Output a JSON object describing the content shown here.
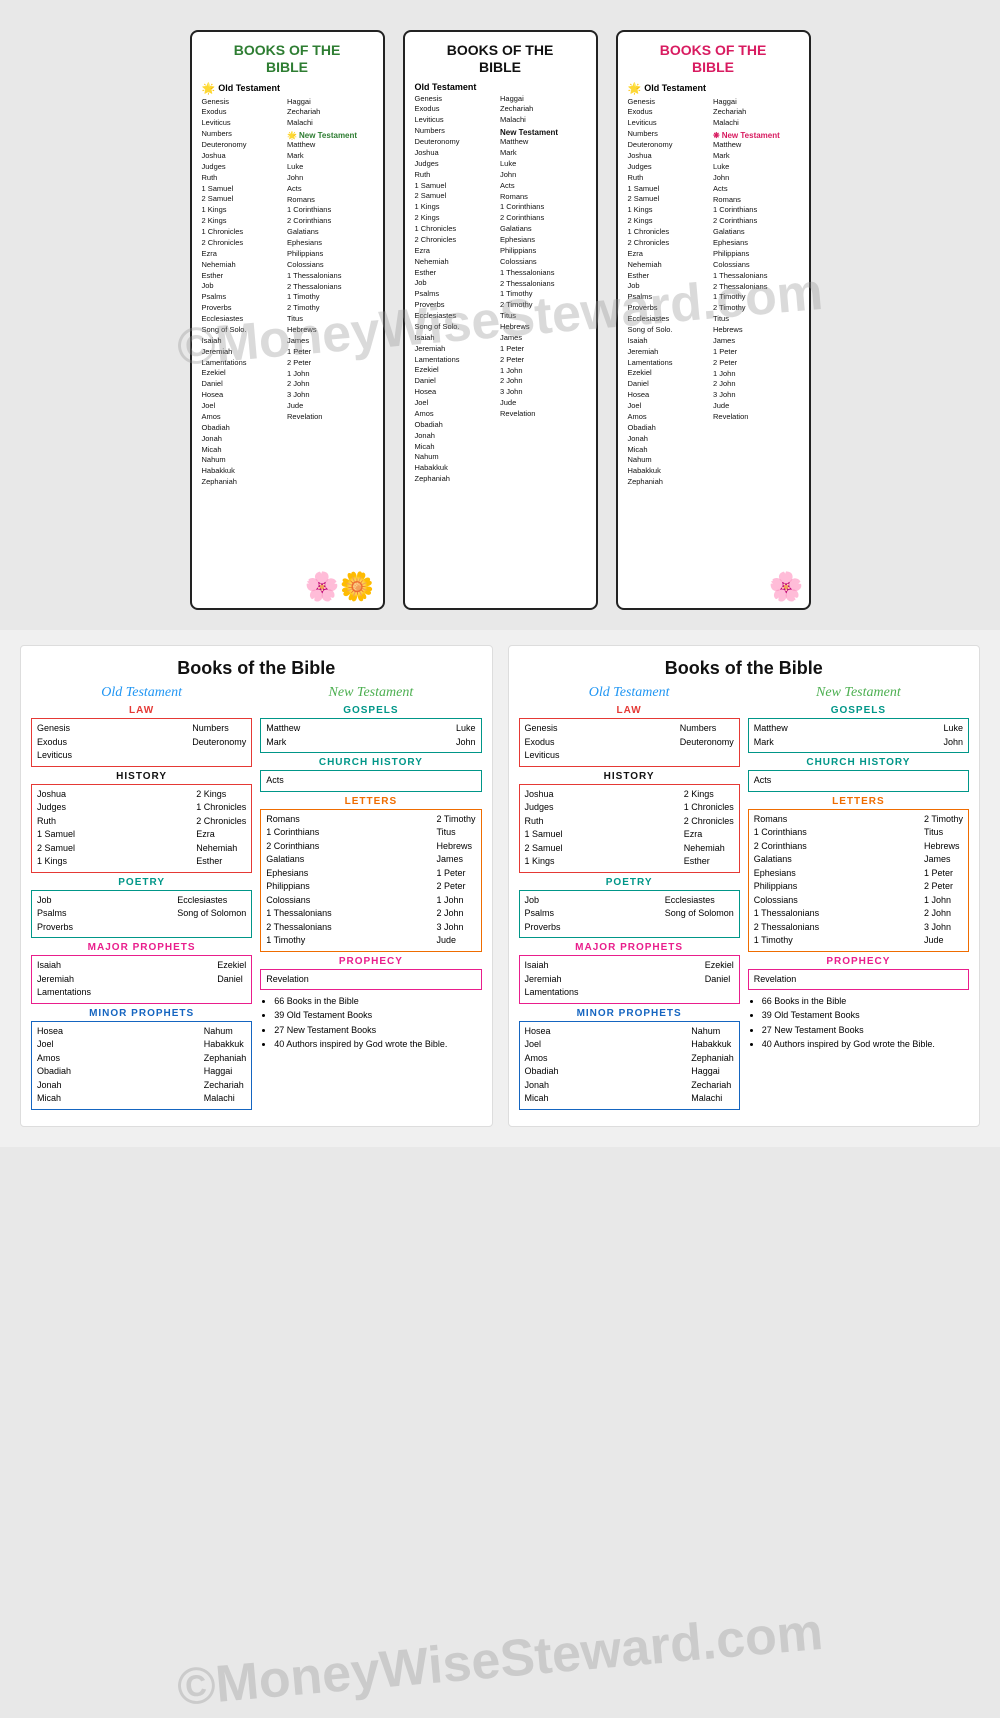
{
  "watermark": "©MoneyWiseSteward.com",
  "top": {
    "bookmarks": [
      {
        "id": "bookmark-1",
        "title": "BOOKS OF THE\nBIBLE",
        "titleColor": "green",
        "oldTestamentLabel": "Old Testament",
        "newTestamentLabel": "New Testament",
        "leftCol": [
          "Genesis",
          "Exodus",
          "Leviticus",
          "Numbers",
          "Deuteronomy",
          "Joshua",
          "Judges",
          "Ruth",
          "1 Samuel",
          "2 Samuel",
          "1 Kings",
          "2 Kings",
          "1 Chronicles",
          "2 Chronicles",
          "Ezra",
          "Nehemiah",
          "Esther",
          "Job",
          "Psalms",
          "Proverbs",
          "Ecclesiastes",
          "Song of Solo.",
          "Isaiah",
          "Jeremiah",
          "Lamentations",
          "Ezekiel",
          "Daniel",
          "Hosea",
          "Joel",
          "Amos",
          "Obadiah",
          "Jonah",
          "Micah",
          "Nahum",
          "Habakkuk",
          "Zephaniah"
        ],
        "rightColOT": [
          "Haggai",
          "Zechariah",
          "Malachi"
        ],
        "rightColNT": [
          "Matthew",
          "Mark",
          "Luke",
          "John",
          "Acts",
          "Romans",
          "1 Corinthians",
          "2 Corinthians",
          "Galatians",
          "Ephesians",
          "Philippians",
          "Colossians",
          "1 Thessalonians",
          "2 Thessalonians",
          "1 Timothy",
          "2 Timothy",
          "Titus",
          "Hebrews",
          "James",
          "1 Peter",
          "2 Peter",
          "1 John",
          "2 John",
          "3 John",
          "Jude",
          "Revelation"
        ],
        "flower": "🌸"
      },
      {
        "id": "bookmark-2",
        "title": "BOOKS OF THE\nBIBLE",
        "titleColor": "black",
        "oldTestamentLabel": "Old Testament",
        "newTestamentLabel": "New Testament",
        "leftCol": [
          "Genesis",
          "Exodus",
          "Leviticus",
          "Numbers",
          "Deuteronomy",
          "Joshua",
          "Judges",
          "Ruth",
          "1 Samuel",
          "2 Samuel",
          "1 Kings",
          "2 Kings",
          "1 Chronicles",
          "2 Chronicles",
          "Ezra",
          "Nehemiah",
          "Esther",
          "Job",
          "Psalms",
          "Proverbs",
          "Ecclesiastes",
          "Song of Solo.",
          "Isaiah",
          "Jeremiah",
          "Lamentations",
          "Ezekiel",
          "Daniel",
          "Hosea",
          "Joel",
          "Amos",
          "Obadiah",
          "Jonah",
          "Micah",
          "Nahum",
          "Habakkuk",
          "Zephaniah"
        ],
        "rightColOT": [
          "Haggai",
          "Zechariah",
          "Malachi"
        ],
        "rightColNT": [
          "Matthew",
          "Mark",
          "Luke",
          "John",
          "Acts",
          "Romans",
          "1 Corinthians",
          "2 Corinthians",
          "Galatians",
          "Ephesians",
          "Philippians",
          "Colossians",
          "1 Thessalonians",
          "2 Thessalonians",
          "1 Timothy",
          "2 Timothy",
          "Titus",
          "Hebrews",
          "James",
          "1 Peter",
          "2 Peter",
          "1 John",
          "2 John",
          "3 John",
          "Jude",
          "Revelation"
        ]
      },
      {
        "id": "bookmark-3",
        "title": "BOOKS OF THE\nBIBLE",
        "titleColor": "pink",
        "oldTestamentLabel": "Old Testament",
        "newTestamentLabel": "New Testament",
        "leftCol": [
          "Genesis",
          "Exodus",
          "Leviticus",
          "Numbers",
          "Deuteronomy",
          "Joshua",
          "Judges",
          "Ruth",
          "1 Samuel",
          "2 Samuel",
          "1 Kings",
          "2 Kings",
          "1 Chronicles",
          "2 Chronicles",
          "Ezra",
          "Nehemiah",
          "Esther",
          "Job",
          "Psalms",
          "Proverbs",
          "Ecclesiastes",
          "Song of Solo.",
          "Isaiah",
          "Jeremiah",
          "Lamentations",
          "Ezekiel",
          "Daniel",
          "Hosea",
          "Joel",
          "Amos",
          "Obadiah",
          "Jonah",
          "Micah",
          "Nahum",
          "Habakkuk",
          "Zephaniah"
        ],
        "rightColOT": [
          "Haggai",
          "Zechariah",
          "Malachi"
        ],
        "rightColNT": [
          "Matthew",
          "Mark",
          "Luke",
          "John",
          "Acts",
          "Romans",
          "1 Corinthians",
          "2 Corinthians",
          "Galatians",
          "Ephesians",
          "Philippians",
          "Colossians",
          "1 Thessalonians",
          "2 Thessalonians",
          "1 Timothy",
          "2 Timothy",
          "Titus",
          "Hebrews",
          "James",
          "1 Peter",
          "2 Peter",
          "1 John",
          "2 John",
          "3 John",
          "Jude",
          "Revelation"
        ],
        "flower": "🌸"
      }
    ]
  },
  "bottom": {
    "sheets": [
      {
        "title": "Books of the Bible",
        "otHeading": "Old Testament",
        "ntHeading": "New Testament",
        "law": {
          "label": "LAW",
          "books": [
            [
              "Genesis",
              "Numbers"
            ],
            [
              "Exodus",
              "Deuteronomy"
            ],
            [
              "Leviticus",
              ""
            ]
          ]
        },
        "history": {
          "label": "HISTORY",
          "booksLeft": [
            "Joshua",
            "Judges",
            "Ruth",
            "1 Samuel",
            "2 Samuel",
            "1 Kings"
          ],
          "booksRight": [
            "2 Kings",
            "1 Chronicles",
            "2 Chronicles",
            "Ezra",
            "Nehemiah",
            "Esther"
          ]
        },
        "poetry": {
          "label": "POETRY",
          "booksLeft": [
            "Job",
            "Psalms",
            "Proverbs"
          ],
          "booksRight": [
            "Ecclesiastes",
            "Song of Solomon"
          ]
        },
        "majorProphets": {
          "label": "MAJOR PROPHETS",
          "booksLeft": [
            "Isaiah",
            "Jeremiah",
            "Lamentations"
          ],
          "booksRight": [
            "Ezekiel",
            "Daniel"
          ]
        },
        "minorProphets": {
          "label": "MINOR PROPHETS",
          "booksLeft": [
            "Hosea",
            "Joel",
            "Amos",
            "Obadiah",
            "Jonah",
            "Micah"
          ],
          "booksRight": [
            "Nahum",
            "Habakkuk",
            "Zephaniah",
            "Haggai",
            "Zechariah",
            "Malachi"
          ]
        },
        "gospels": {
          "label": "GOSPELS",
          "books": [
            [
              "Matthew",
              "Luke"
            ],
            [
              "Mark",
              "John"
            ]
          ]
        },
        "churchHistory": {
          "label": "CHURCH HISTORY",
          "books": [
            "Acts"
          ]
        },
        "letters": {
          "label": "LETTERS",
          "booksLeft": [
            "Romans",
            "1 Corinthians",
            "2 Corinthians",
            "Galatians",
            "Ephesians",
            "Philippians",
            "Colossians",
            "1 Thessalonians",
            "2 Thessalonians",
            "1 Timothy"
          ],
          "booksRight": [
            "2 Timothy",
            "Titus",
            "Hebrews",
            "James",
            "1 Peter",
            "2 Peter",
            "1 John",
            "2 John",
            "3 John",
            "Jude"
          ]
        },
        "prophecy": {
          "label": "PROPHECY",
          "books": [
            "Revelation"
          ]
        },
        "bullets": [
          "66 Books in the Bible",
          "39 Old Testament Books",
          "27 New Testament Books",
          "40 Authors inspired by God wrote the Bible."
        ]
      }
    ]
  }
}
